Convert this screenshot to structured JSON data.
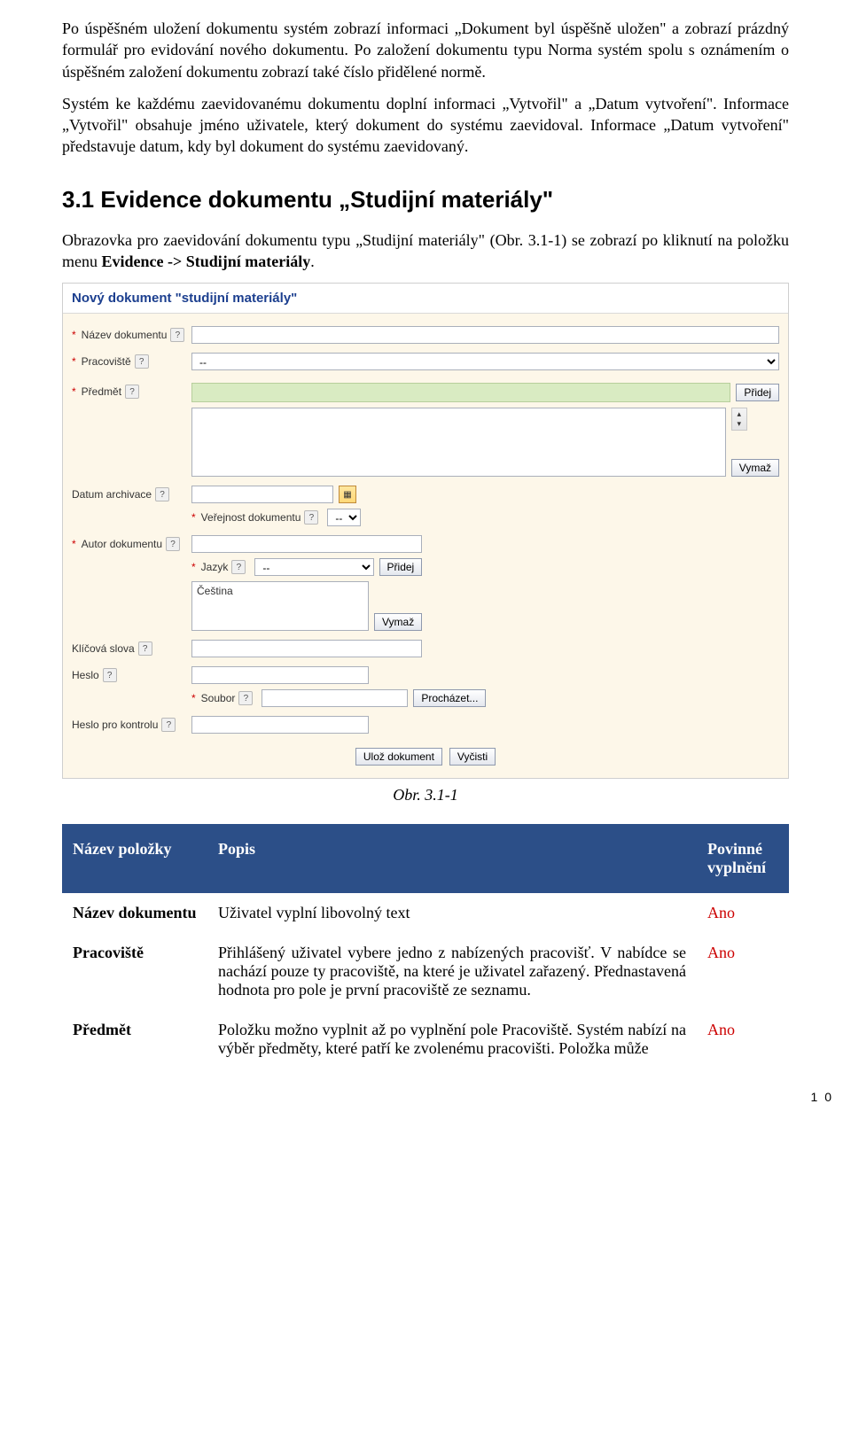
{
  "body": {
    "p1": "Po úspěšném uložení dokumentu systém zobrazí informaci „Dokument byl úspěšně uložen\" a zobrazí prázdný formulář pro evidování nového dokumentu. Po založení dokumentu typu Norma systém spolu s oznámením o úspěšném založení dokumentu zobrazí také číslo přidělené normě.",
    "p2": "Systém ke každému zaevidovanému dokumentu doplní informaci „Vytvořil\" a „Datum vytvoření\". Informace „Vytvořil\" obsahuje jméno uživatele, který dokument do systému zaevidoval. Informace „Datum vytvoření\" představuje datum, kdy byl dokument do systému zaevidovaný.",
    "h_section": "3.1    Evidence dokumentu „Studijní materiály\"",
    "p3_a": "Obrazovka pro zaevidování dokumentu typu „Studijní materiály\" (Obr. 3.1-1) se zobrazí po kliknutí na položku menu ",
    "p3_b": "Evidence -> Studijní materiály",
    "p3_c": ".",
    "fig_caption": "Obr. 3.1-1"
  },
  "form": {
    "title": "Nový dokument \"studijní materiály\"",
    "labels": {
      "nazev": "Název dokumentu",
      "pracoviste": "Pracoviště",
      "predmet": "Předmět",
      "datum_arch": "Datum archivace",
      "verejnost": "Veřejnost dokumentu",
      "autor": "Autor dokumentu",
      "jazyk": "Jazyk",
      "klicova": "Klíčová slova",
      "heslo": "Heslo",
      "heslo_kontrola": "Heslo pro kontrolu",
      "soubor": "Soubor"
    },
    "values": {
      "pracoviste_selected": "--",
      "verejnost_selected": "--",
      "jazyk_selected": "--",
      "lang_list_item": "Čeština"
    },
    "buttons": {
      "pridej": "Přidej",
      "vymaz": "Vymaž",
      "prochazet": "Procházet...",
      "uloz": "Ulož dokument",
      "vycisti": "Vyčisti"
    },
    "req_mark": "*",
    "help_mark": "?"
  },
  "table": {
    "headers": {
      "col1": "Název položky",
      "col2": "Popis",
      "col3": "Povinné vyplnění"
    },
    "rows": [
      {
        "name": "Název dokumentu",
        "desc": "Uživatel vyplní libovolný text",
        "req": "Ano"
      },
      {
        "name": "Pracoviště",
        "desc": "Přihlášený uživatel vybere jedno z nabízených pracovišť. V nabídce se nachází pouze ty pracoviště, na které je uživatel zařazený. Přednastavená hodnota pro pole je první pracoviště ze seznamu.",
        "req": "Ano"
      },
      {
        "name": "Předmět",
        "desc": "Položku možno vyplnit až po vyplnění pole Pracoviště. Systém nabízí na výběr předměty, které patří ke zvolenému pracovišti. Položka může",
        "req": "Ano"
      }
    ]
  },
  "page_number": "1 0"
}
